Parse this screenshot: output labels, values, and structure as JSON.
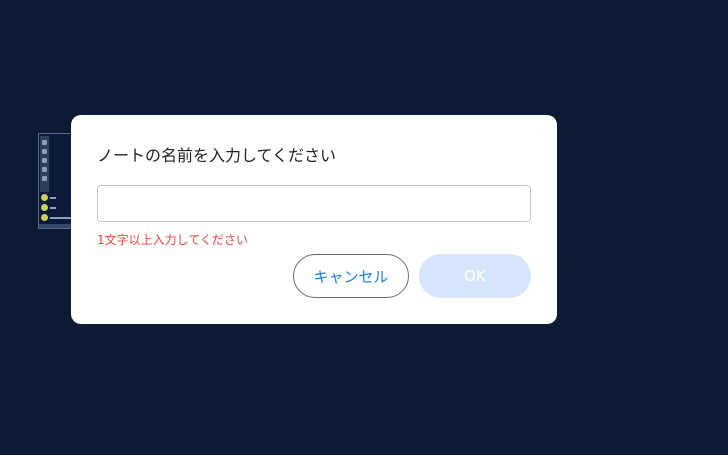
{
  "dialog": {
    "title": "ノートの名前を入力してください",
    "input_value": "",
    "input_placeholder": "",
    "error_message": "1文字以上入力してください",
    "cancel_label": "キャンセル",
    "ok_label": "OK"
  },
  "colors": {
    "backdrop": "#0d1a33",
    "error": "#e8463a",
    "cancel_text": "#1d7fe0",
    "ok_disabled_bg": "#d5e6fb"
  }
}
